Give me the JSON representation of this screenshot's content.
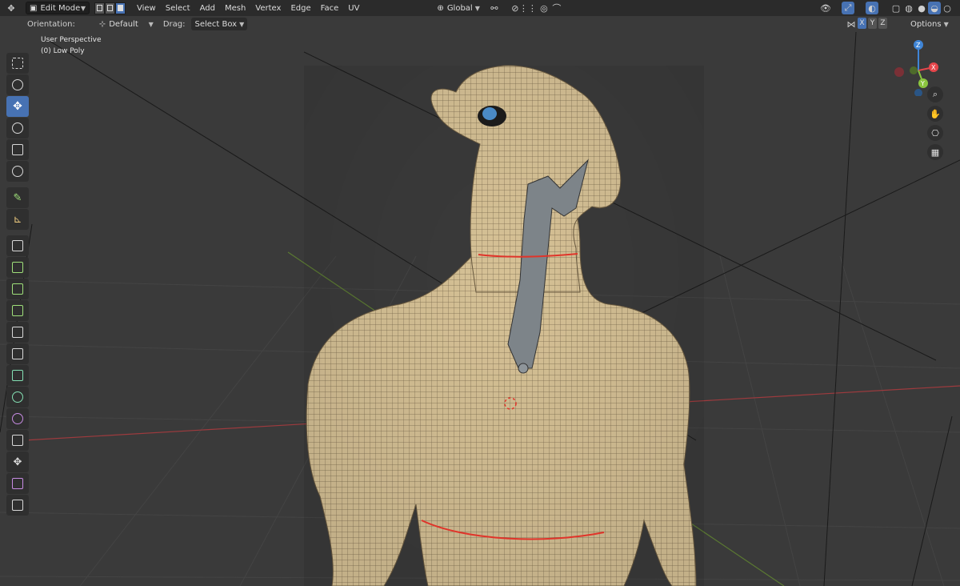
{
  "header": {
    "mode": "Edit Mode",
    "menus": [
      "View",
      "Select",
      "Add",
      "Mesh",
      "Vertex",
      "Edge",
      "Face",
      "UV"
    ],
    "transform_orientation": "Global"
  },
  "tool_settings": {
    "orientation_label": "Orientation:",
    "orientation_value": "Default",
    "drag_label": "Drag:",
    "drag_value": "Select Box",
    "axes": [
      "X",
      "Y",
      "Z"
    ],
    "options": "Options"
  },
  "viewport": {
    "view_name": "User Perspective",
    "object_info": "(0) Low Poly"
  },
  "gizmo": {
    "x": "X",
    "y": "Y",
    "z": "Z",
    "colors": {
      "x": "#e5464b",
      "y": "#8bc53f",
      "z": "#3f85d7"
    }
  },
  "toolbar_tools": [
    "select-box-icon",
    "cursor-icon",
    "move-icon",
    "rotate-icon",
    "scale-icon",
    "transform-icon",
    "annotate-icon",
    "measure-icon",
    "add-cube-icon",
    "extrude-icon",
    "inset-icon",
    "bevel-icon",
    "loop-cut-icon",
    "knife-icon",
    "poly-build-icon",
    "spin-icon",
    "smooth-icon",
    "edge-slide-icon",
    "shrink-fatten-icon",
    "shear-icon",
    "rip-icon"
  ],
  "colors": {
    "accent": "#4772b3",
    "background": "#3a3a3a",
    "mesh": "#d9c39a",
    "seam": "#e0342a"
  }
}
